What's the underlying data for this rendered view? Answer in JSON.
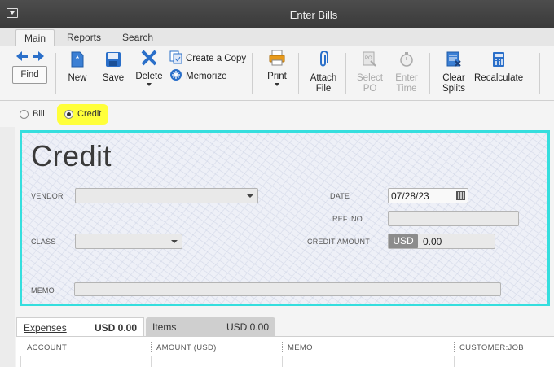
{
  "window": {
    "title": "Enter Bills"
  },
  "tabs": [
    {
      "label": "Main",
      "active": true
    },
    {
      "label": "Reports",
      "active": false
    },
    {
      "label": "Search",
      "active": false
    }
  ],
  "toolbar": {
    "find": "Find",
    "new": "New",
    "save": "Save",
    "delete": "Delete",
    "create_copy": "Create a Copy",
    "memorize": "Memorize",
    "print": "Print",
    "attach_file": [
      "Attach",
      "File"
    ],
    "select_po": [
      "Select",
      "PO"
    ],
    "enter_time": [
      "Enter",
      "Time"
    ],
    "clear_splits": [
      "Clear",
      "Splits"
    ],
    "recalculate": "Recalculate"
  },
  "type_selector": {
    "bill": "Bill",
    "credit": "Credit",
    "selected": "Credit"
  },
  "form": {
    "title": "Credit",
    "vendor_label": "VENDOR",
    "vendor_value": "",
    "class_label": "CLASS",
    "class_value": "",
    "date_label": "DATE",
    "date_value": "07/28/23",
    "ref_label": "REF. NO.",
    "ref_value": "",
    "credit_amount_label": "CREDIT AMOUNT",
    "currency": "USD",
    "credit_amount_value": "0.00",
    "memo_label": "MEMO",
    "memo_value": ""
  },
  "detail_tabs": {
    "expenses_label": "Expenses",
    "expenses_amount": "USD  0.00",
    "items_label": "Items",
    "items_amount": "USD  0.00"
  },
  "table": {
    "columns": [
      "ACCOUNT",
      "AMOUNT (USD)",
      "MEMO",
      "CUSTOMER:JOB"
    ]
  },
  "colors": {
    "form_border": "#35dede",
    "highlight": "#ffff3a",
    "icon_blue": "#2a6fc9"
  }
}
